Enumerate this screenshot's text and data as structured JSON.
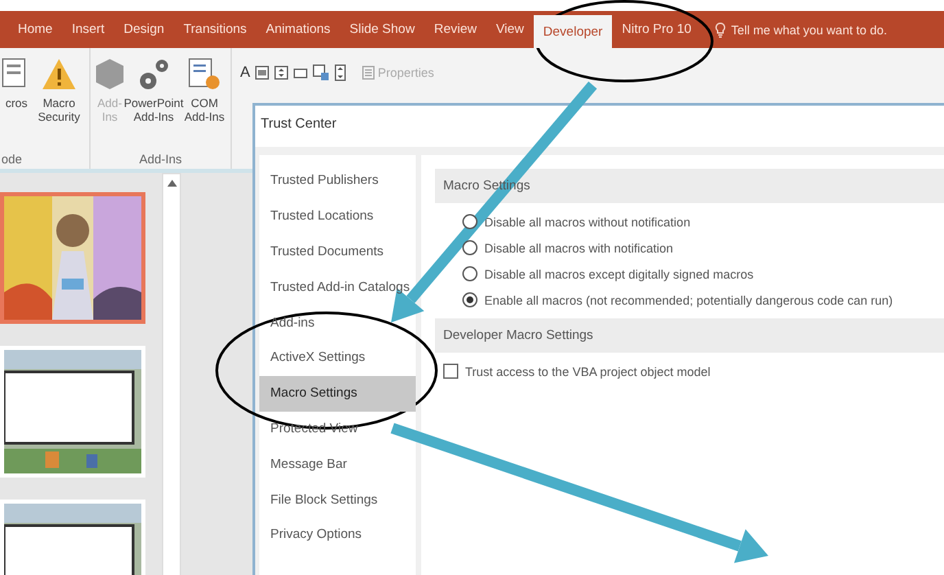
{
  "ribbon_tabs": [
    {
      "label": "Home",
      "selected": false
    },
    {
      "label": "Insert",
      "selected": false
    },
    {
      "label": "Design",
      "selected": false
    },
    {
      "label": "Transitions",
      "selected": false
    },
    {
      "label": "Animations",
      "selected": false
    },
    {
      "label": "Slide Show",
      "selected": false
    },
    {
      "label": "Review",
      "selected": false
    },
    {
      "label": "View",
      "selected": false
    },
    {
      "label": "Developer",
      "selected": true
    },
    {
      "label": "Nitro Pro 10",
      "selected": false
    }
  ],
  "tell_me": "Tell me what you want to do.",
  "ribbon_groups": [
    {
      "label": "ode",
      "buttons": [
        {
          "kind": "macros",
          "label": "cros",
          "disabled": false
        },
        {
          "kind": "security",
          "label": "Macro Security",
          "disabled": false
        }
      ]
    },
    {
      "label": "Add-Ins",
      "buttons": [
        {
          "kind": "addins",
          "label": "Add-Ins",
          "disabled": true
        },
        {
          "kind": "gears",
          "label": "PowerPoint Add-Ins",
          "disabled": false
        },
        {
          "kind": "com",
          "label": "COM Add-Ins",
          "disabled": false
        }
      ]
    }
  ],
  "controls": {
    "letter": "A",
    "properties": {
      "label": "Properties",
      "disabled": true
    }
  },
  "slides": [
    {
      "kind": "picture",
      "selected": true
    },
    {
      "kind": "picture",
      "selected": false
    },
    {
      "kind": "picture",
      "selected": false
    }
  ],
  "dialog": {
    "title": "Trust Center",
    "nav": [
      {
        "label": "Trusted Publishers",
        "selected": false
      },
      {
        "label": "Trusted Locations",
        "selected": false
      },
      {
        "label": "Trusted Documents",
        "selected": false
      },
      {
        "label": "Trusted Add-in Catalogs",
        "selected": false
      },
      {
        "label": "Add-ins",
        "selected": false
      },
      {
        "label": "ActiveX Settings",
        "selected": false
      },
      {
        "label": "Macro Settings",
        "selected": true
      },
      {
        "label": "Protected View",
        "selected": false
      },
      {
        "label": "Message Bar",
        "selected": false
      },
      {
        "label": "File Block Settings",
        "selected": false
      },
      {
        "label": "Privacy Options",
        "selected": false
      }
    ],
    "sections": [
      {
        "heading": "Macro Settings",
        "options": [
          {
            "kind": "radio",
            "label": "Disable all macros without notification",
            "selected": false
          },
          {
            "kind": "radio",
            "label": "Disable all macros with notification",
            "selected": false
          },
          {
            "kind": "radio",
            "label": "Disable all macros except digitally signed macros",
            "selected": false
          },
          {
            "kind": "radio",
            "label": "Enable all macros (not recommended; potentially dangerous code can run)",
            "selected": true
          }
        ]
      },
      {
        "heading": "Developer Macro Settings",
        "options": [
          {
            "kind": "checkbox",
            "label": "Trust access to the VBA project object model",
            "checked": false
          }
        ]
      }
    ]
  },
  "annotations": [
    {
      "kind": "ellipse",
      "color": "#000000"
    },
    {
      "kind": "ellipse",
      "color": "#000000"
    },
    {
      "kind": "arrow",
      "color": "#4aaec8"
    },
    {
      "kind": "arrow",
      "color": "#4aaec8"
    }
  ]
}
